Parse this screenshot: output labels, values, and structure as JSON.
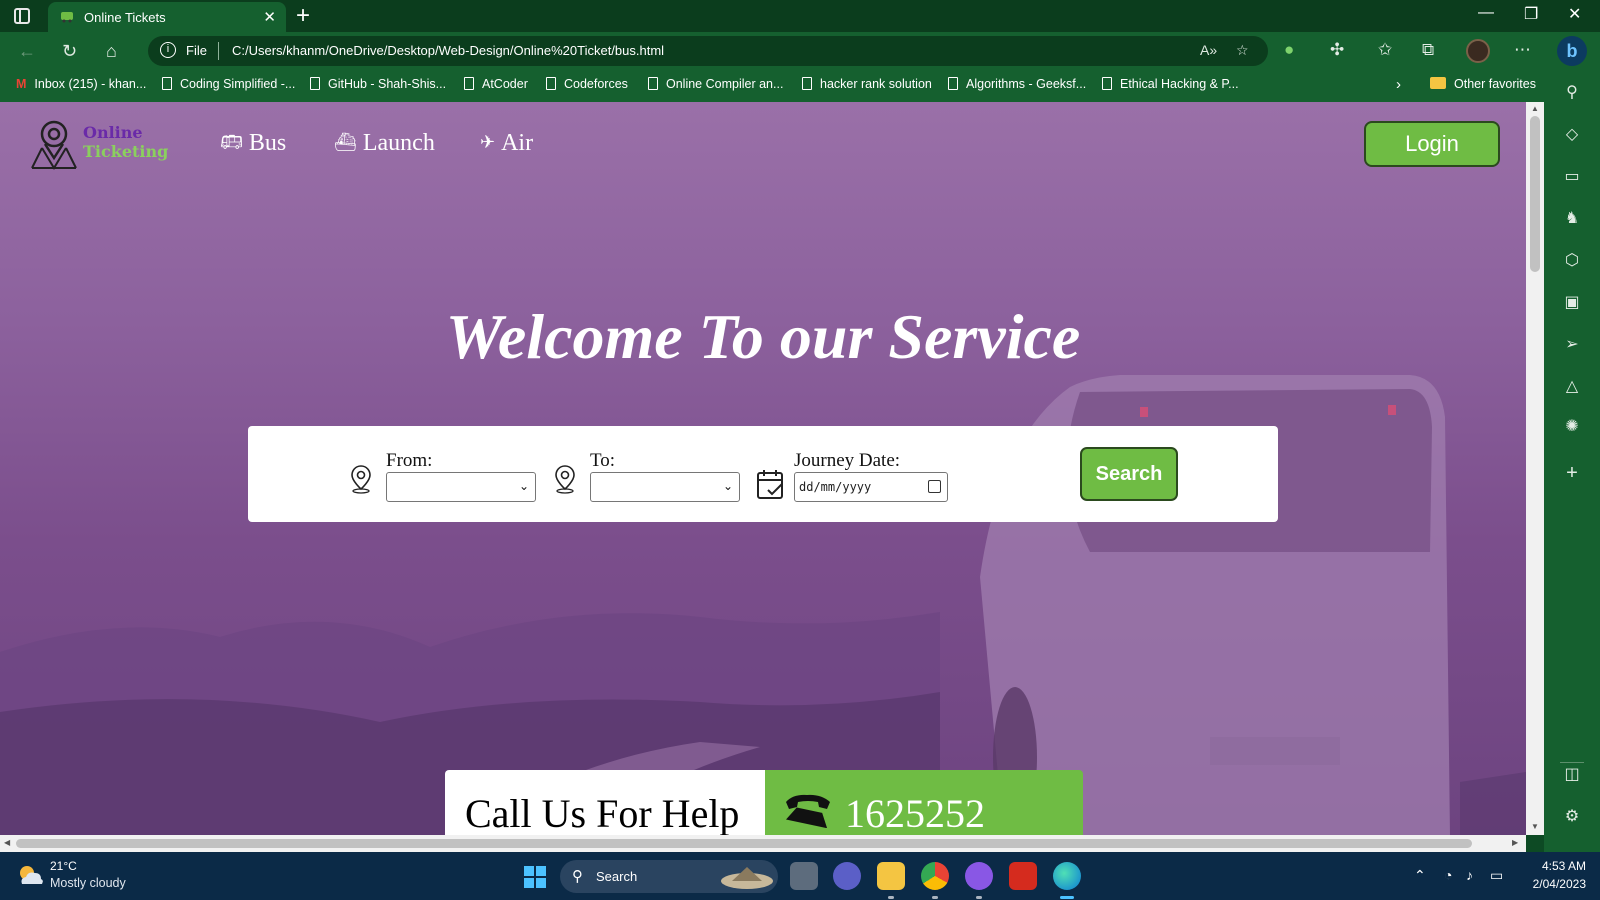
{
  "browser": {
    "tab_title": "Online Tickets",
    "tab_close": "✕",
    "new_tab": "+",
    "window": {
      "minimize": "—",
      "maximize": "❐",
      "close": "✕"
    },
    "address": {
      "scheme_label": "File",
      "url": "C:/Users/khanm/OneDrive/Desktop/Web-Design/Online%20Ticket/bus.html"
    },
    "favorites": [
      {
        "label": "Inbox (215) - khan...",
        "icon": "gmail-icon"
      },
      {
        "label": "Coding Simplified -...",
        "icon": "page-icon"
      },
      {
        "label": "GitHub - Shah-Shis...",
        "icon": "page-icon"
      },
      {
        "label": "AtCoder",
        "icon": "page-icon"
      },
      {
        "label": "Codeforces",
        "icon": "page-icon"
      },
      {
        "label": "Online Compiler an...",
        "icon": "page-icon"
      },
      {
        "label": "hacker rank solution",
        "icon": "page-icon"
      },
      {
        "label": "Algorithms - Geeksf...",
        "icon": "page-icon"
      },
      {
        "label": "Ethical Hacking & P...",
        "icon": "page-icon"
      }
    ],
    "other_favorites": "Other favorites"
  },
  "site": {
    "logo_line1": "Online",
    "logo_line2": "Ticketing",
    "nav": [
      {
        "label": "Bus",
        "icon": "bus-icon"
      },
      {
        "label": "Launch",
        "icon": "ship-icon"
      },
      {
        "label": "Air",
        "icon": "plane-icon"
      }
    ],
    "login_label": "Login",
    "welcome": "Welcome To our Service",
    "search": {
      "from_label": "From:",
      "from_value": "",
      "to_label": "To:",
      "to_value": "",
      "date_label": "Journey Date:",
      "date_placeholder": "dd/mm/yyyy",
      "button_label": "Search"
    },
    "help_text": "Call Us For Help",
    "help_number": "1625252"
  },
  "taskbar": {
    "temperature": "21°C",
    "condition": "Mostly cloudy",
    "search_label": "Search",
    "time": "4:53 AM",
    "date": "2/04/2023"
  },
  "colors": {
    "brand_green": "#6fbc44",
    "logo_purple": "#6a2aa8",
    "chrome_green": "#15602f",
    "hero_purple": "#8c619d"
  }
}
